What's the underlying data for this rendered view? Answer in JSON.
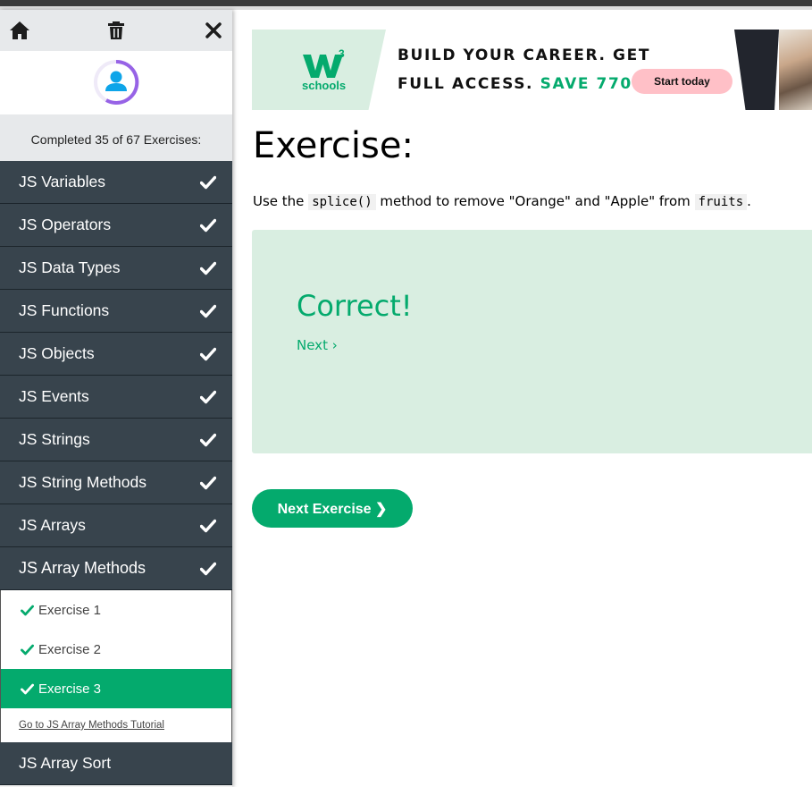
{
  "sidebar": {
    "progress_text": "Completed 35 of 67 Exercises:",
    "categories_before": [
      {
        "label": "JS Variables"
      },
      {
        "label": "JS Operators"
      },
      {
        "label": "JS Data Types"
      },
      {
        "label": "JS Functions"
      },
      {
        "label": "JS Objects"
      },
      {
        "label": "JS Events"
      },
      {
        "label": "JS Strings"
      },
      {
        "label": "JS String Methods"
      },
      {
        "label": "JS Arrays"
      },
      {
        "label": "JS Array Methods"
      }
    ],
    "exercises": [
      {
        "label": "Exercise 1"
      },
      {
        "label": "Exercise 2"
      },
      {
        "label": "Exercise 3"
      }
    ],
    "tutorial_link": "Go to JS Array Methods Tutorial",
    "categories_after": [
      {
        "label": "JS Array Sort"
      }
    ]
  },
  "banner": {
    "logo_text": "schools",
    "logo_sup": "3",
    "headline_1": "BUILD YOUR CAREER. GET",
    "headline_2a": "FULL ACCESS. ",
    "headline_2b": "SAVE 770$",
    "cta": "Start today"
  },
  "main": {
    "title": "Exercise:",
    "instruction": {
      "pre": "Use the ",
      "code1": "splice()",
      "mid": " method to remove \"Orange\" and \"Apple\" from ",
      "code2": "fruits",
      "post": "."
    },
    "result": "Correct!",
    "next_link": "Next ›",
    "next_button": "Next Exercise ❯"
  },
  "colors": {
    "accent": "#04aa6d",
    "sidebar_dark": "#38444d",
    "result_bg": "#d9eee1"
  }
}
